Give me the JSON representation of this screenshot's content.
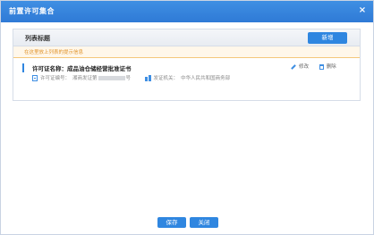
{
  "dialog": {
    "title": "前置许可集合",
    "close_glyph": "×"
  },
  "panel": {
    "title": "列表标题",
    "new_button": "新增",
    "hint": "在这里放上列表的提示信息"
  },
  "items": [
    {
      "name": "许可证名称：成品油仓储经营批准证书",
      "license_label": "许可证编号：",
      "license_prefix": "湘商发证第",
      "license_suffix": "号",
      "issuer_label": "发证机关：",
      "issuer_value": "中华人民共和国商务部",
      "edit_label": "修改",
      "delete_label": "删除"
    }
  ],
  "footer": {
    "save": "保存",
    "close": "关闭"
  },
  "colors": {
    "primary": "#2f86e0",
    "title_bar": "#3f8fe3",
    "hint_text": "#e0932a"
  }
}
